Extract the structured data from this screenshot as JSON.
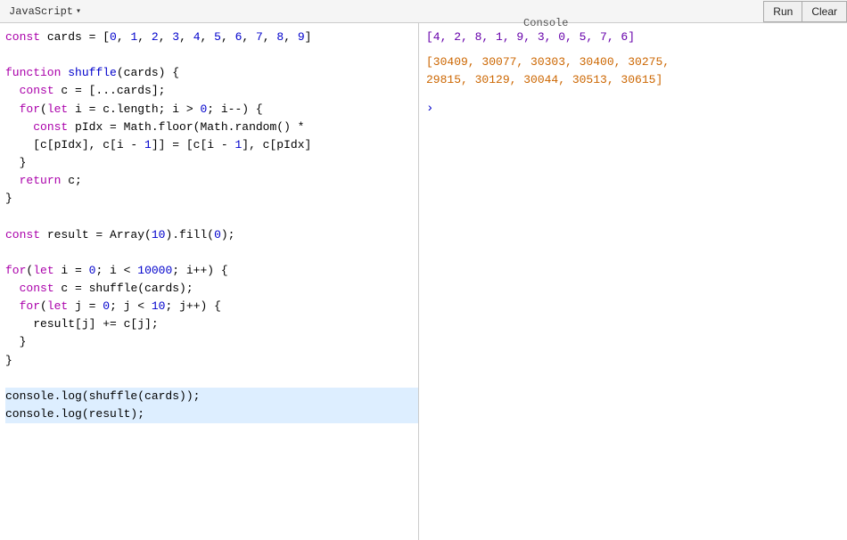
{
  "topbar": {
    "language": "JavaScript",
    "chevron": "▾",
    "run_label": "Run",
    "clear_label": "Clear",
    "console_label": "Console"
  },
  "editor": {
    "lines": [
      {
        "id": 1,
        "text": "const cards = [0, 1, 2, 3, 4, 5, 6, 7, 8, 9]"
      },
      {
        "id": 2,
        "text": ""
      },
      {
        "id": 3,
        "text": "function shuffle(cards) {"
      },
      {
        "id": 4,
        "text": "  const c = [...cards];"
      },
      {
        "id": 5,
        "text": "  for(let i = c.length; i > 0; i--) {"
      },
      {
        "id": 6,
        "text": "    const pIdx = Math.floor(Math.random() *"
      },
      {
        "id": 7,
        "text": "    [c[pIdx], c[i - 1]] = [c[i - 1], c[pIdx]"
      },
      {
        "id": 8,
        "text": "  }"
      },
      {
        "id": 9,
        "text": "  return c;"
      },
      {
        "id": 10,
        "text": "}"
      },
      {
        "id": 11,
        "text": ""
      },
      {
        "id": 12,
        "text": "const result = Array(10).fill(0);"
      },
      {
        "id": 13,
        "text": ""
      },
      {
        "id": 14,
        "text": "for(let i = 0; i < 10000; i++) {"
      },
      {
        "id": 15,
        "text": "  const c = shuffle(cards);"
      },
      {
        "id": 16,
        "text": "  for(let j = 0; j < 10; j++) {"
      },
      {
        "id": 17,
        "text": "    result[j] += c[j];"
      },
      {
        "id": 18,
        "text": "  }"
      },
      {
        "id": 19,
        "text": "}"
      },
      {
        "id": 20,
        "text": ""
      },
      {
        "id": 21,
        "text": "console.log(shuffle(cards));"
      },
      {
        "id": 22,
        "text": "console.log(result);"
      }
    ]
  },
  "console": {
    "output1": "[4, 2, 8, 1, 9, 3, 0, 5, 7, 6]",
    "output2": "[30409, 30077, 30303, 30400, 30275,",
    "output3": " 29815, 30129, 30044, 30513, 30615]",
    "prompt": "›"
  }
}
